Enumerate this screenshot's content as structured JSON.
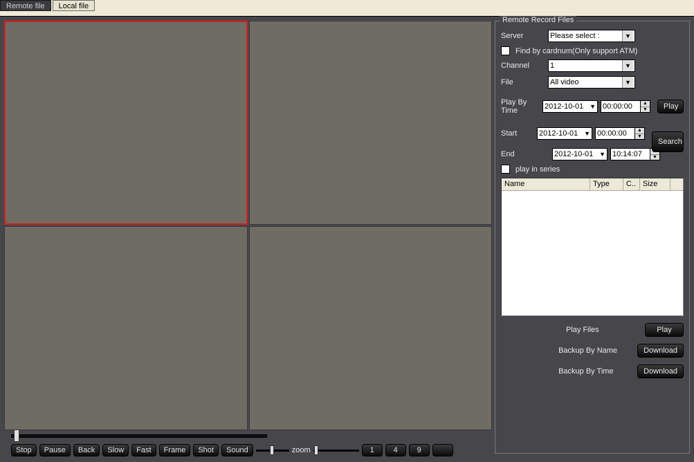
{
  "tabs": {
    "remote": "Remote file",
    "local": "Local file"
  },
  "panel": {
    "legend": "Remote Record Files",
    "server_label": "Server",
    "server_value": "Please select :",
    "find_cardnum": "Find by cardnum(Only support ATM)",
    "channel_label": "Channel",
    "channel_value": "1",
    "file_label": "File",
    "file_value": "All video",
    "playbytime_label": "Play By Time",
    "date1": "2012-10-01",
    "time1": "00:00:00",
    "play_btn": "Play",
    "start_label": "Start",
    "date2": "2012-10-01",
    "time2": "00:00:00",
    "search_btn": "Search",
    "end_label": "End",
    "date3": "2012-10-01",
    "time3": "10:14:07",
    "play_series": "play in series",
    "th_name": "Name",
    "th_type": "Type",
    "th_c": "C..",
    "th_size": "Size",
    "play_files_label": "Play Files",
    "play_files_btn": "Play",
    "backup_name_label": "Backup By Name",
    "backup_name_btn": "Download",
    "backup_time_label": "Backup By Time",
    "backup_time_btn": "Download"
  },
  "toolbar": {
    "stop": "Stop",
    "pause": "Pause",
    "back": "Back",
    "slow": "Slow",
    "fast": "Fast",
    "frame": "Frame",
    "shot": "Shot",
    "sound": "Sound",
    "zoom": "zoom",
    "layout1": "1",
    "layout4": "4",
    "layout9": "9"
  }
}
